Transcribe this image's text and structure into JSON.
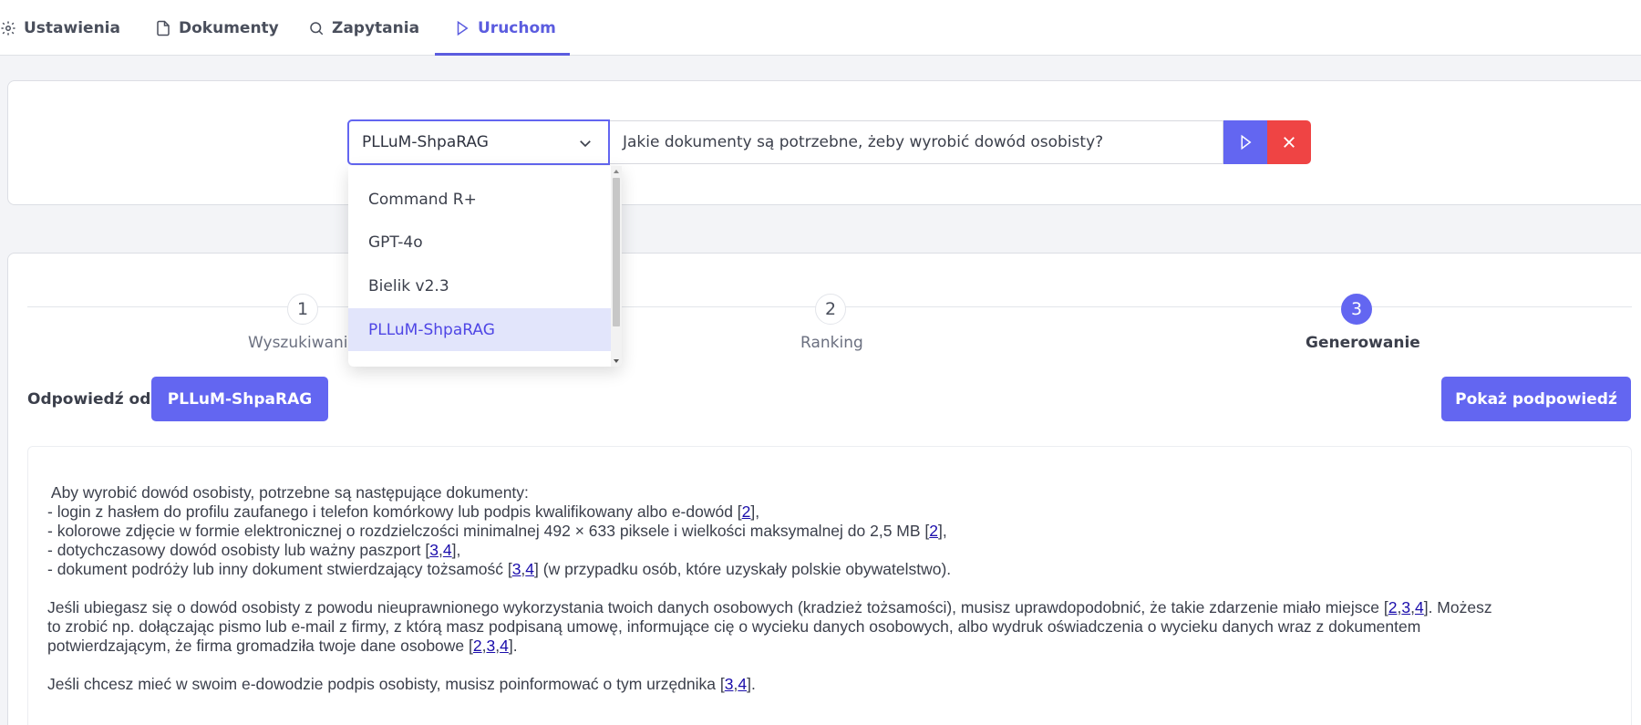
{
  "nav": {
    "tabs": [
      {
        "label": "Ustawienia",
        "icon": "gear-icon"
      },
      {
        "label": "Dokumenty",
        "icon": "document-icon"
      },
      {
        "label": "Zapytania",
        "icon": "search-icon"
      },
      {
        "label": "Uruchom",
        "icon": "play-icon",
        "active": true
      }
    ]
  },
  "query": {
    "selected_model": "PLLuM-ShpaRAG",
    "input_value": "Jakie dokumenty są potrzebne, żeby wyrobić dowód osobisty?",
    "run_icon": "play-icon",
    "clear_icon": "close-icon"
  },
  "dropdown": {
    "options": [
      "Command R+",
      "GPT-4o",
      "Bielik v2.3",
      "PLLuM-ShpaRAG"
    ],
    "selected": "PLLuM-ShpaRAG"
  },
  "steps": [
    {
      "number": "1",
      "label": "Wyszukiwanie"
    },
    {
      "number": "2",
      "label": "Ranking"
    },
    {
      "number": "3",
      "label": "Generowanie",
      "active": true
    }
  ],
  "answer": {
    "from_label": "Odpowiedź od:",
    "model_badge": "PLLuM-ShpaRAG",
    "hint_button": "Pokaż podpowiedź",
    "intro": " Aby wyrobić dowód osobisty, potrzebne są następujące dokumenty:",
    "lines": [
      {
        "text": "- login z hasłem do profilu zaufanego i telefon komórkowy lub podpis kwalifikowany albo e-dowód [",
        "refs": [
          "2"
        ],
        "tail": "],"
      },
      {
        "text": "- kolorowe zdjęcie w formie elektronicznej o rozdzielczości minimalnej 492 × 633 piksele i wielkości maksymalnej do 2,5 MB [",
        "refs": [
          "2"
        ],
        "tail": "],"
      },
      {
        "text": "- dotychczasowy dowód osobisty lub ważny paszport [",
        "refs": [
          "3",
          "4"
        ],
        "tail": "],"
      },
      {
        "text": "- dokument podróży lub inny dokument stwierdzający tożsamość [",
        "refs": [
          "3",
          "4"
        ],
        "tail": "] (w przypadku osób, które uzyskały polskie obywatelstwo)."
      }
    ],
    "para2_line1": "Jeśli ubiegasz się o dowód osobisty z powodu nieuprawnionego wykorzystania twoich danych osobowych (kradzież tożsamości), musisz uprawdopodobnić, że takie zdarzenie miało miejsce [",
    "para2_line1_refs": [
      "2",
      "3",
      "4"
    ],
    "para2_line1_tail": "]. Możesz",
    "para2_line2": "to zrobić np. dołączając pismo lub e-mail z firmy, z którą masz podpisaną umowę, informujące cię o wycieku danych osobowych, albo wydruk oświadczenia o wycieku danych wraz z dokumentem",
    "para2_line3": "potwierdzającym, że firma gromadziła twoje dane osobowe [",
    "para2_line3_refs": [
      "2",
      "3",
      "4"
    ],
    "para2_line3_tail": "].",
    "para3": "Jeśli chcesz mieć w swoim e-dowodzie podpis osobisty, musisz poinformować o tym urzędnika [",
    "para3_refs": [
      "3",
      "4"
    ],
    "para3_tail": "]."
  },
  "colors": {
    "accent": "#6366f1",
    "danger": "#ef4444",
    "selected_bg": "#e2e5fb"
  }
}
